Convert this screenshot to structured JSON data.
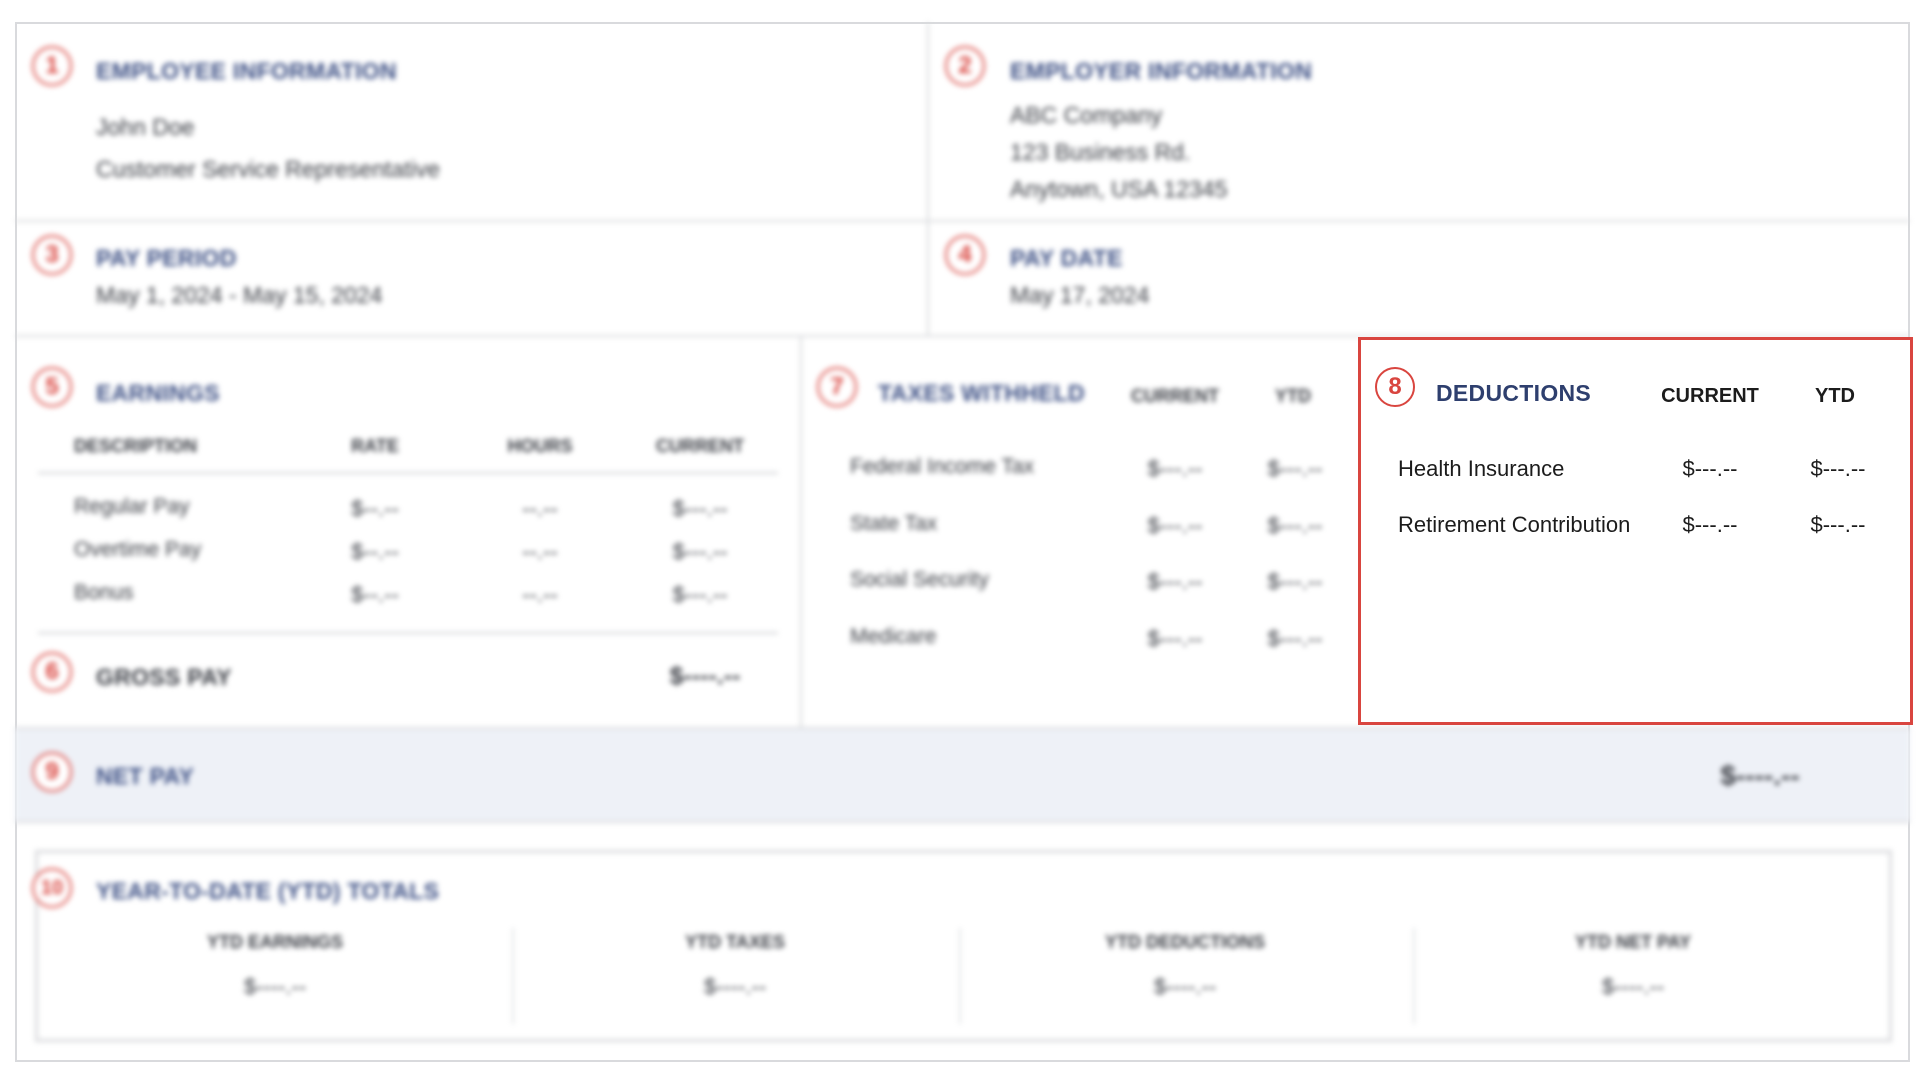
{
  "employee": {
    "badge": "1",
    "title": "EMPLOYEE INFORMATION",
    "name": "John Doe",
    "role": "Customer Service Representative"
  },
  "employer": {
    "badge": "2",
    "title": "EMPLOYER INFORMATION",
    "company": "ABC Company",
    "address1": "123 Business Rd.",
    "address2": "Anytown, USA 12345"
  },
  "pay_period": {
    "badge": "3",
    "title": "PAY PERIOD",
    "value": "May 1, 2024 - May 15, 2024"
  },
  "pay_date": {
    "badge": "4",
    "title": "PAY DATE",
    "value": "May 17, 2024"
  },
  "earnings": {
    "badge": "5",
    "title": "EARNINGS",
    "columns": [
      "DESCRIPTION",
      "RATE",
      "HOURS",
      "CURRENT"
    ],
    "rows": [
      {
        "description": "Regular Pay",
        "rate": "$--.--",
        "hours": "--.--",
        "current": "$---.--"
      },
      {
        "description": "Overtime Pay",
        "rate": "$--.--",
        "hours": "--.--",
        "current": "$---.--"
      },
      {
        "description": "Bonus",
        "rate": "$--.--",
        "hours": "--.--",
        "current": "$---.--"
      }
    ]
  },
  "gross_pay": {
    "badge": "6",
    "title": "GROSS PAY",
    "value": "$----.--"
  },
  "taxes": {
    "badge": "7",
    "title": "TAXES WITHHELD",
    "col_current": "CURRENT",
    "col_ytd": "YTD",
    "rows": [
      {
        "label": "Federal Income Tax",
        "current": "$---.--",
        "ytd": "$---.--"
      },
      {
        "label": "State Tax",
        "current": "$---.--",
        "ytd": "$---.--"
      },
      {
        "label": "Social Security",
        "current": "$---.--",
        "ytd": "$---.--"
      },
      {
        "label": "Medicare",
        "current": "$---.--",
        "ytd": "$---.--"
      }
    ]
  },
  "deductions": {
    "badge": "8",
    "title": "DEDUCTIONS",
    "col_current": "CURRENT",
    "col_ytd": "YTD",
    "rows": [
      {
        "label": "Health Insurance",
        "current": "$---.--",
        "ytd": "$---.--"
      },
      {
        "label": "Retirement Contribution",
        "current": "$---.--",
        "ytd": "$---.--"
      }
    ],
    "highlight_color": "#d9453f"
  },
  "net_pay": {
    "badge": "9",
    "title": "NET PAY",
    "value": "$----.--"
  },
  "ytd_totals": {
    "badge": "10",
    "title": "YEAR-TO-DATE (YTD) TOTALS",
    "items": [
      {
        "label": "YTD EARNINGS",
        "value": "$----.--"
      },
      {
        "label": "YTD TAXES",
        "value": "$----.--"
      },
      {
        "label": "YTD DEDUCTIONS",
        "value": "$----.--"
      },
      {
        "label": "YTD NET PAY",
        "value": "$----.--"
      }
    ]
  }
}
